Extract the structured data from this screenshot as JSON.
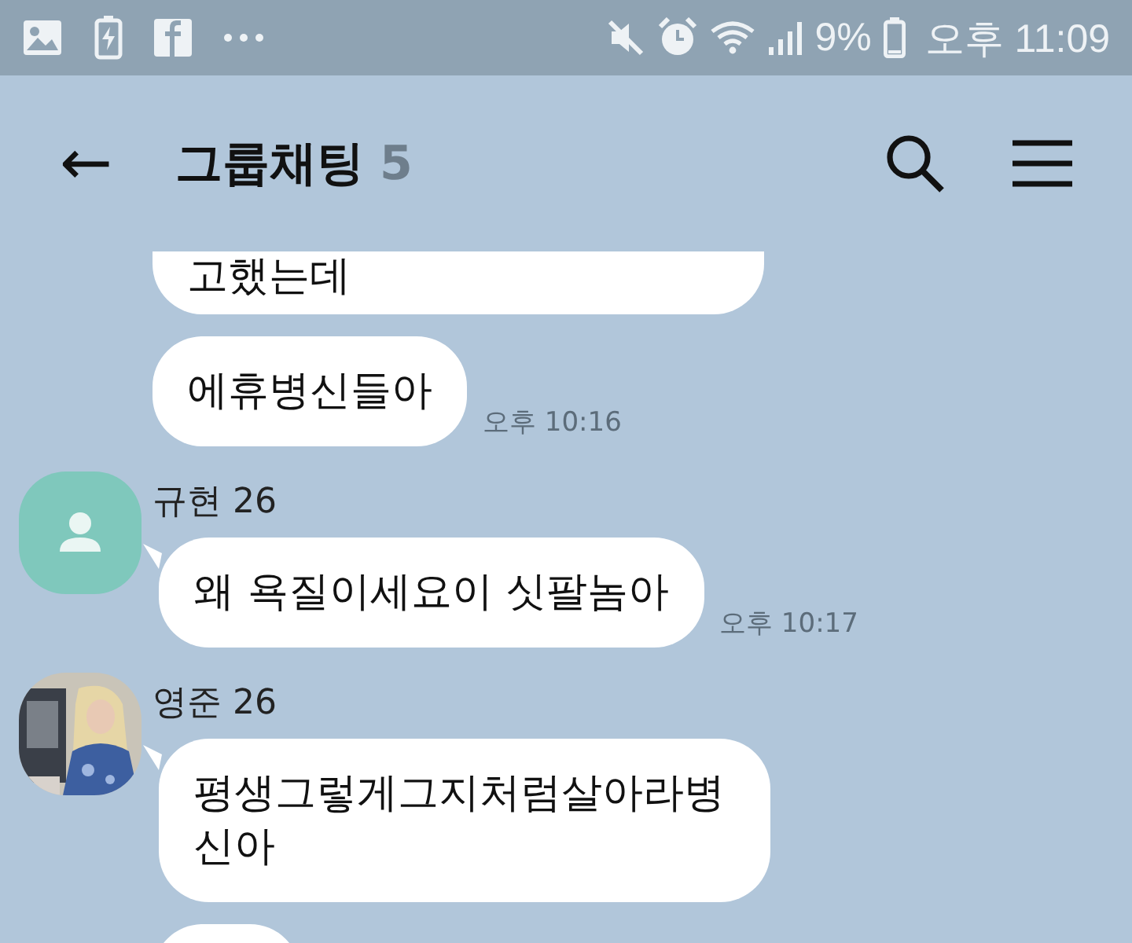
{
  "status_bar": {
    "battery_text": "9%",
    "time": "오후 11:09"
  },
  "header": {
    "back": "←",
    "title": "그룹채팅",
    "member_count": "5"
  },
  "messages": [
    {
      "kind": "clipped",
      "text": "고했는데"
    },
    {
      "kind": "plain",
      "text": "에휴병신들아",
      "time": "오후 10:16"
    },
    {
      "kind": "sender",
      "avatar": {
        "kind": "default"
      },
      "sender": "규현 26",
      "text": "왜 욕질이세요이 싯팔놈아",
      "time": "오후 10:17"
    },
    {
      "kind": "sender",
      "sender": "영준 26",
      "text": "평생그렇게그지처럼살아라병신아"
    },
    {
      "kind": "cut"
    }
  ]
}
